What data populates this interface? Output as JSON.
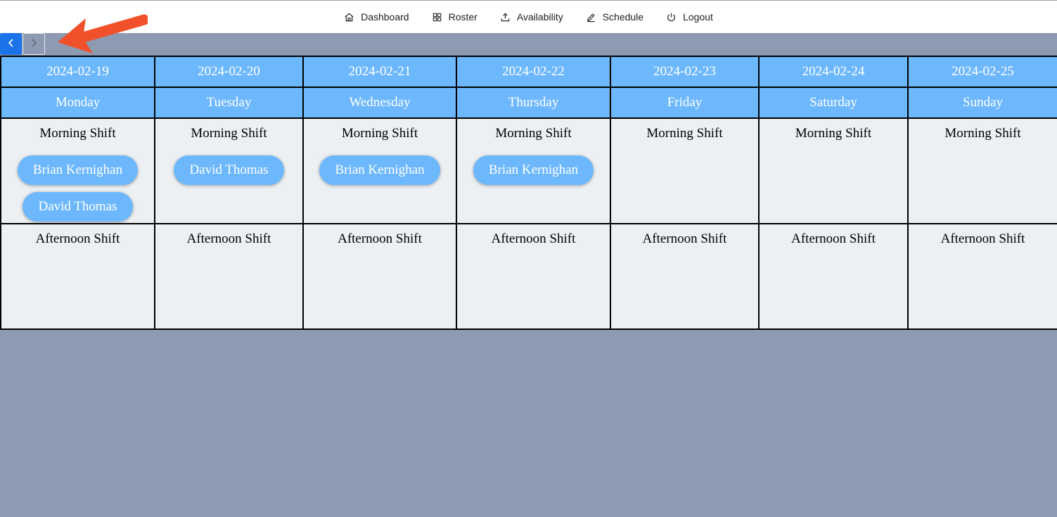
{
  "nav": {
    "items": [
      {
        "label": "Dashboard",
        "icon": "home-icon"
      },
      {
        "label": "Roster",
        "icon": "grid-icon"
      },
      {
        "label": "Availability",
        "icon": "upload-icon"
      },
      {
        "label": "Schedule",
        "icon": "pencil-icon"
      },
      {
        "label": "Logout",
        "icon": "power-icon"
      }
    ]
  },
  "pager": {
    "prev_label": "<",
    "next_label": ">"
  },
  "colors": {
    "accent": "#6db8fc",
    "prev_button": "#1a73e8",
    "annotation_arrow": "#f0502a",
    "background": "#8d9ab1"
  },
  "calendar": {
    "days": [
      {
        "date": "2024-02-19",
        "day": "Monday"
      },
      {
        "date": "2024-02-20",
        "day": "Tuesday"
      },
      {
        "date": "2024-02-21",
        "day": "Wednesday"
      },
      {
        "date": "2024-02-22",
        "day": "Thursday"
      },
      {
        "date": "2024-02-23",
        "day": "Friday"
      },
      {
        "date": "2024-02-24",
        "day": "Saturday"
      },
      {
        "date": "2024-02-25",
        "day": "Sunday"
      }
    ],
    "shifts": [
      {
        "title": "Morning Shift",
        "assignments": [
          [
            "Brian Kernighan",
            "David Thomas"
          ],
          [
            "David Thomas"
          ],
          [
            "Brian Kernighan"
          ],
          [
            "Brian Kernighan"
          ],
          [],
          [],
          []
        ]
      },
      {
        "title": "Afternoon Shift",
        "assignments": [
          [],
          [],
          [],
          [],
          [],
          [],
          []
        ]
      }
    ]
  }
}
